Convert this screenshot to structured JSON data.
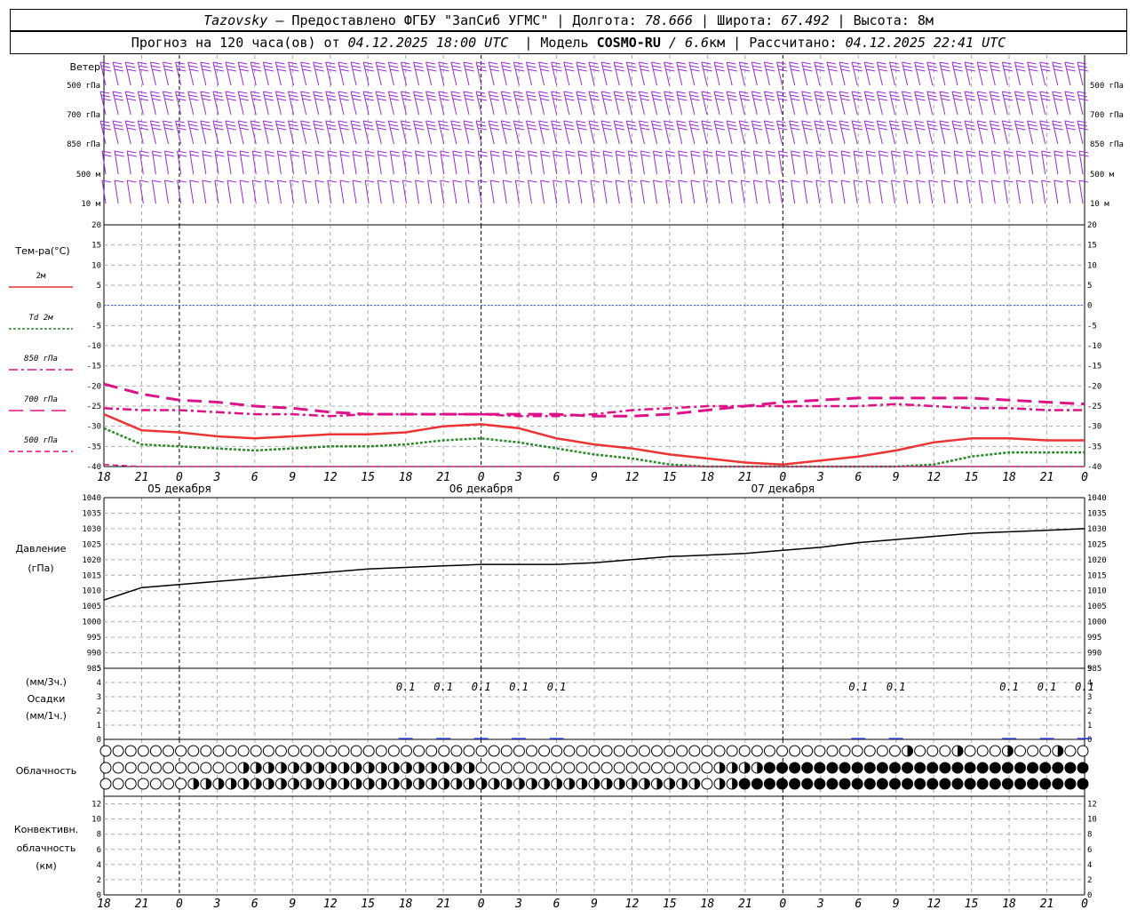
{
  "header": {
    "station": "Tazovsky",
    "dash": " — ",
    "provided": "Предоставлено ФГБУ \"ЗапСиб УГМС\"",
    "sep": " | ",
    "lon_label": "Долгота: ",
    "lon": "78.666",
    "lat_label": "Широта: ",
    "lat": "67.492",
    "alt_label": "Высота: ",
    "alt": "8м",
    "forecast_label": "Прогноз на 120 часа(ов) от ",
    "forecast_start": "04.12.2025 18:00 UTC",
    "model_label": "  | Модель ",
    "model": "COSMO-RU",
    "model_res": " / 6.6",
    "model_res_unit": "км",
    "calc_label": " | Рассчитано: ",
    "calc_time": "04.12.2025 22:41 UTC"
  },
  "chart_data": [
    {
      "type": "barbs",
      "id": "wind",
      "title": "Ветер",
      "levels": [
        "500 гПа",
        "700 гПа",
        "850 гПа",
        "500 м",
        "10  м"
      ],
      "colors": {
        "barb": "#9a2bd8"
      }
    },
    {
      "type": "line",
      "id": "temp",
      "ylabel": "Тем-ра(°C)",
      "ylim": [
        -40,
        20
      ],
      "yticks": [
        20,
        15,
        10,
        5,
        0,
        -5,
        -10,
        -15,
        -20,
        -25,
        -30,
        -35,
        -40
      ],
      "x_hours": [
        0,
        3,
        6,
        9,
        12,
        15,
        18,
        21,
        24,
        27,
        30,
        33,
        36,
        39,
        42,
        45,
        48,
        51,
        54,
        57,
        60,
        63,
        66,
        69,
        72,
        75,
        78
      ],
      "series": [
        {
          "name": "2м",
          "color": "#ee3333",
          "style": "solid",
          "values": [
            -27,
            -31,
            -31.5,
            -32.5,
            -33,
            -32.5,
            -32,
            -32,
            -31.5,
            -30,
            -29.5,
            -30.5,
            -33,
            -34.5,
            -35.5,
            -37,
            -38,
            -39,
            -39.5,
            -38.5,
            -37.5,
            -36,
            -34,
            -33,
            -33,
            -33.5,
            -33.5
          ]
        },
        {
          "name": "Td 2м",
          "color": "#2a8a2a",
          "style": "dotted",
          "values": [
            -30.5,
            -34.5,
            -35,
            -35.5,
            -36,
            -35.5,
            -35,
            -35,
            -34.5,
            -33.5,
            -33,
            -34,
            -35.5,
            -37,
            -38,
            -39.5,
            -40,
            -41,
            -42,
            -42.5,
            -42.5,
            -42,
            -39.5,
            -37.5,
            -36.5,
            -36.5,
            -36.5
          ]
        },
        {
          "name": "850 гПа",
          "color": "#dd1188",
          "style": "dashdot",
          "values": [
            -25.5,
            -26,
            -26,
            -26.5,
            -27,
            -27,
            -27.5,
            -27,
            -27,
            -27,
            -27,
            -27.5,
            -27.5,
            -27,
            -26,
            -25.5,
            -25,
            -25,
            -25,
            -25,
            -25,
            -24.5,
            -25,
            -25.5,
            -25.5,
            -26,
            -26
          ]
        },
        {
          "name": "700 гПа",
          "color": "#dd1188",
          "style": "dashed",
          "values": [
            -19.5,
            -22,
            -23.5,
            -24,
            -25,
            -25.5,
            -26.5,
            -27,
            -27,
            -27,
            -27,
            -27,
            -27,
            -27.5,
            -27.5,
            -27,
            -26,
            -25,
            -24,
            -23.5,
            -23,
            -23,
            -23,
            -23,
            -23.5,
            -24,
            -24.5
          ]
        },
        {
          "name": "500 гПа",
          "color": "#dd1188",
          "style": "dashed_thin",
          "values": [
            -39.5,
            -40,
            -40.5,
            -40.5,
            -40.5,
            -40.5,
            -40.5,
            -40.5,
            -40.5,
            -40.5,
            -40.5,
            -40.5,
            -40.5,
            -40.5,
            -40.5,
            -40.5,
            -40.5,
            -40.5,
            -40.5,
            -40.5,
            -40.5,
            -40.5,
            -40.5,
            -40.5,
            -40.5,
            -40.5,
            -40.5
          ]
        }
      ]
    },
    {
      "type": "line",
      "id": "pressure",
      "ylabel": "Давление",
      "yunit": "(гПа)",
      "ylim": [
        985,
        1040
      ],
      "yticks": [
        1040,
        1035,
        1030,
        1025,
        1020,
        1015,
        1010,
        1005,
        1000,
        995,
        990,
        985
      ],
      "x_hours": [
        0,
        3,
        6,
        9,
        12,
        15,
        18,
        21,
        24,
        27,
        30,
        33,
        36,
        39,
        42,
        45,
        48,
        51,
        54,
        57,
        60,
        63,
        66,
        69,
        72,
        75,
        78
      ],
      "values": [
        1007,
        1011,
        1012,
        1013,
        1014,
        1015,
        1016,
        1017,
        1017.5,
        1018,
        1018.5,
        1018.5,
        1018.5,
        1019,
        1020,
        1021,
        1021.5,
        1022,
        1023,
        1024,
        1025.5,
        1026.5,
        1027.5,
        1028.5,
        1029,
        1029.5,
        1030
      ]
    },
    {
      "type": "bar",
      "id": "precip",
      "ylabel": "(мм/3ч.)",
      "ylabel2": "Осадки",
      "ylabel3": "(мм/1ч.)",
      "ylim": [
        0,
        5
      ],
      "yticks": [
        5,
        4,
        3,
        2,
        1,
        0
      ],
      "labels": [
        {
          "h": 24,
          "text": "0.1"
        },
        {
          "h": 27,
          "text": "0.1"
        },
        {
          "h": 30,
          "text": "0.1"
        },
        {
          "h": 33,
          "text": "0.1"
        },
        {
          "h": 36,
          "text": "0.1"
        },
        {
          "h": 60,
          "text": "0.1"
        },
        {
          "h": 63,
          "text": "0.1"
        },
        {
          "h": 72,
          "text": "0.1"
        },
        {
          "h": 75,
          "text": "0.1"
        },
        {
          "h": 78,
          "text": "0.1"
        }
      ]
    },
    {
      "type": "symbols",
      "id": "cloud",
      "label": "Облачность"
    },
    {
      "type": "bar",
      "id": "convective",
      "ylabel": "Конвективн.",
      "ylabel2": "облачность",
      "ylabel3": "(км)",
      "ylim": [
        0,
        13
      ],
      "yticks": [
        12,
        10,
        8,
        6,
        4,
        2,
        0
      ]
    }
  ],
  "time_axis": {
    "labels": [
      "18",
      "21",
      "0",
      "3",
      "6",
      "9",
      "12",
      "15",
      "18",
      "21",
      "0",
      "3",
      "6",
      "9",
      "12",
      "15",
      "18",
      "21",
      "0",
      "3",
      "6",
      "9",
      "12",
      "15",
      "18",
      "21",
      "0"
    ],
    "days": [
      {
        "h": 6,
        "text": "05 декабря"
      },
      {
        "h": 30,
        "text": "06 декабря"
      },
      {
        "h": 54,
        "text": "07 декабря"
      }
    ],
    "midnights": [
      6,
      30,
      54,
      78
    ]
  }
}
